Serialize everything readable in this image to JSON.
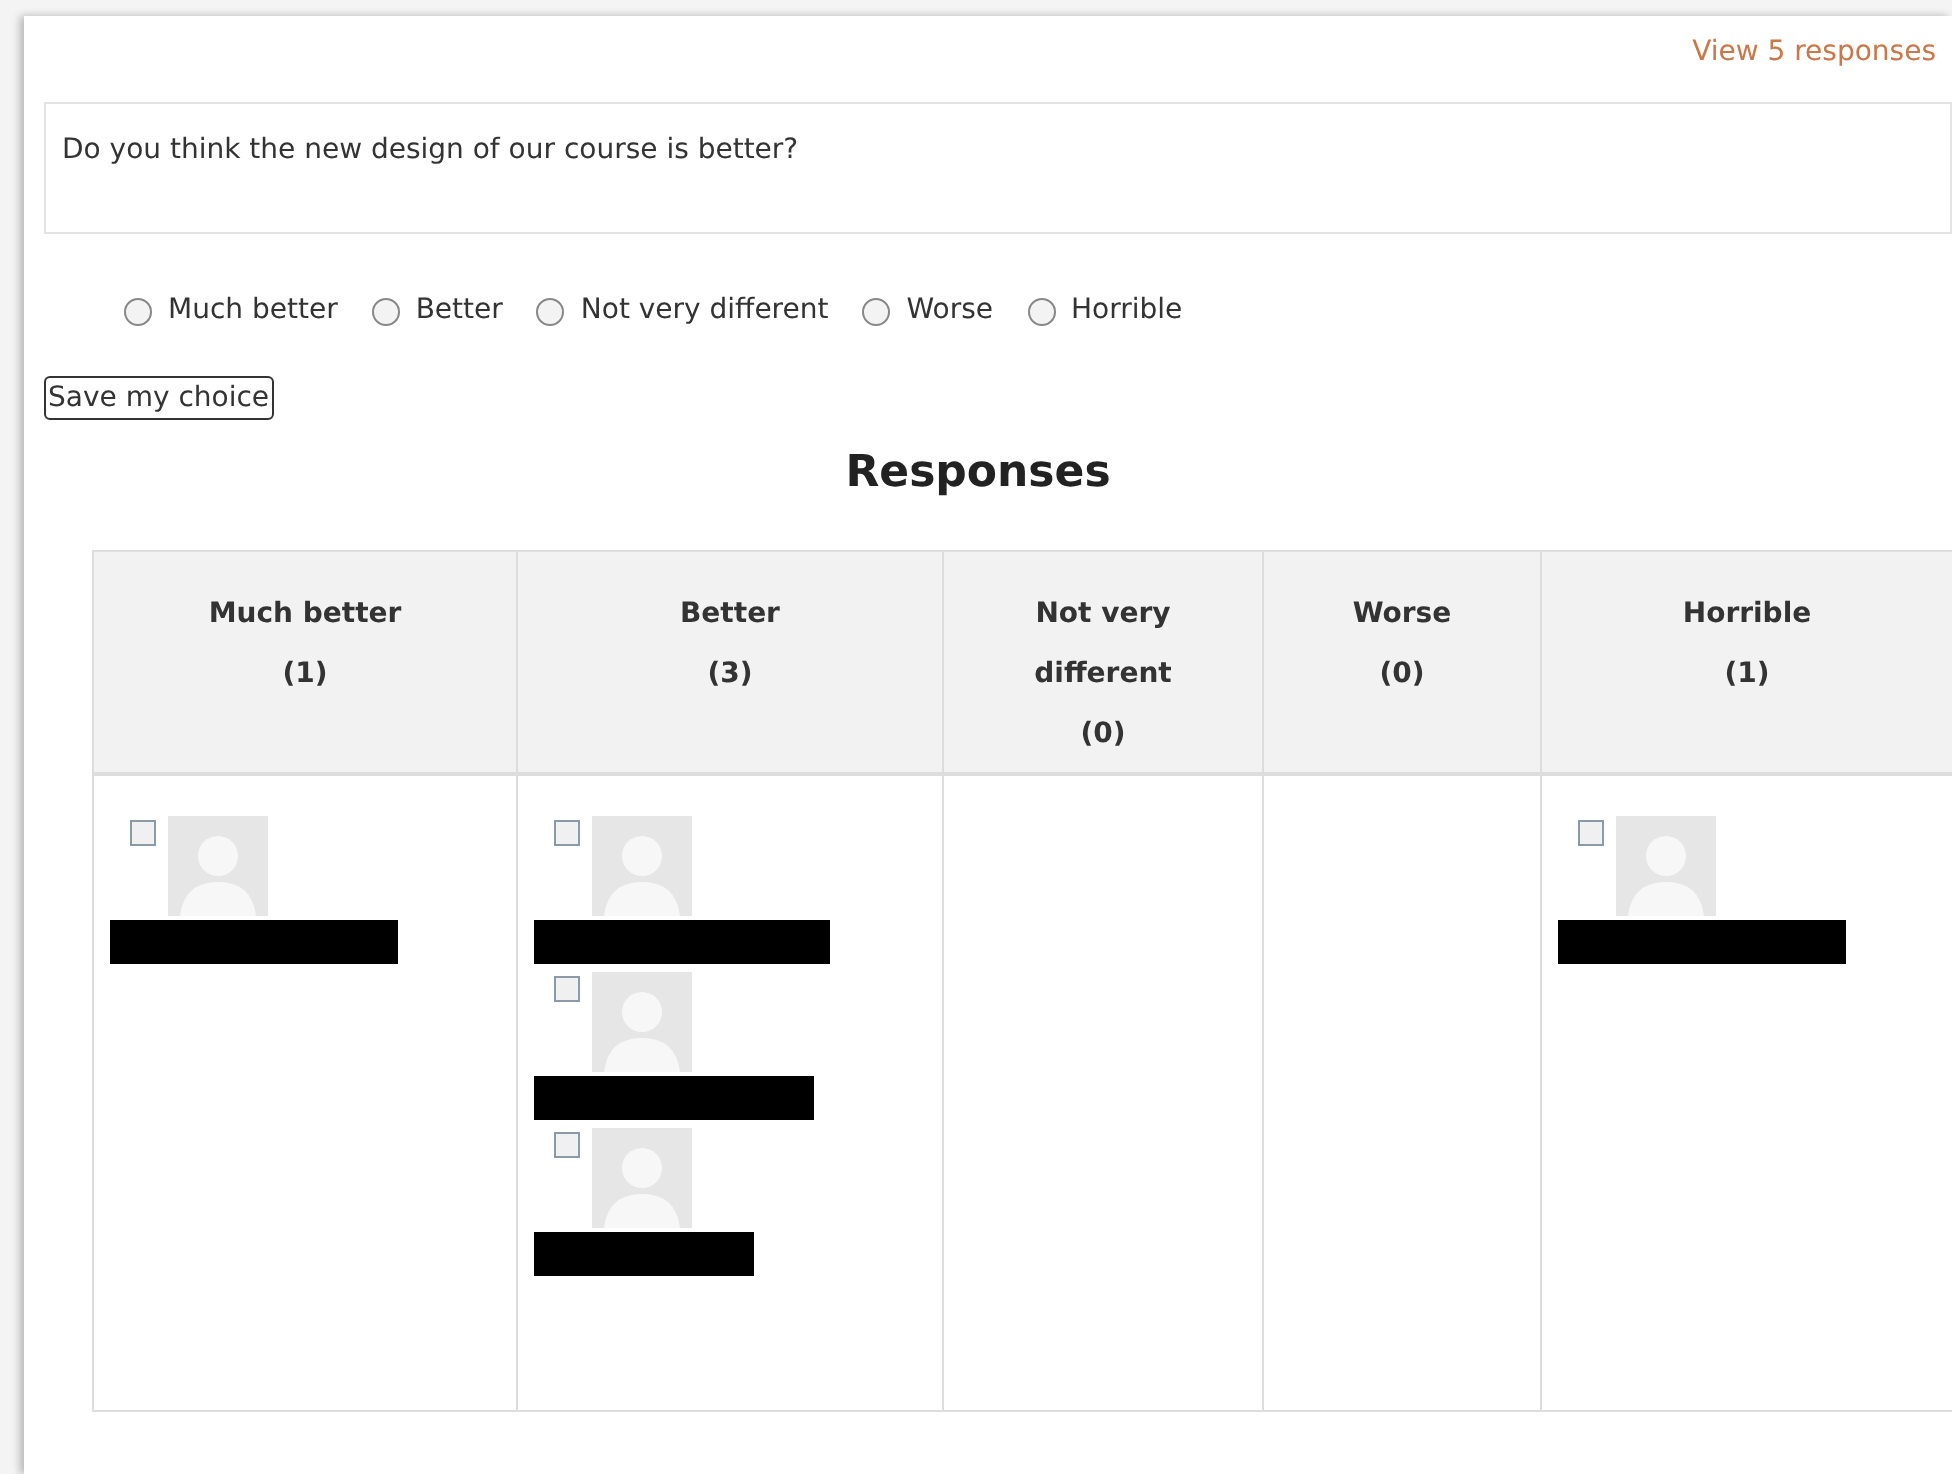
{
  "view_responses_link": "View 5 responses",
  "question": "Do you think the new design of our course is better?",
  "options": [
    {
      "label": "Much better",
      "selected": false
    },
    {
      "label": "Better",
      "selected": false
    },
    {
      "label": "Not very different",
      "selected": false
    },
    {
      "label": "Worse",
      "selected": false
    },
    {
      "label": "Horrible",
      "selected": false
    }
  ],
  "save_button": "Save my choice",
  "responses_title": "Responses",
  "columns": [
    {
      "title": "Much better",
      "count": "(1)",
      "responses": [
        {
          "checked": false
        }
      ]
    },
    {
      "title": "Better",
      "count": "(3)",
      "responses": [
        {
          "checked": false
        },
        {
          "checked": false
        },
        {
          "checked": false
        }
      ]
    },
    {
      "title": "Not very different",
      "count": "(0)"
    },
    {
      "title": "Worse",
      "count": "(0)"
    },
    {
      "title": "Horrible",
      "count": "(1)",
      "responses": [
        {
          "checked": false
        }
      ]
    }
  ]
}
